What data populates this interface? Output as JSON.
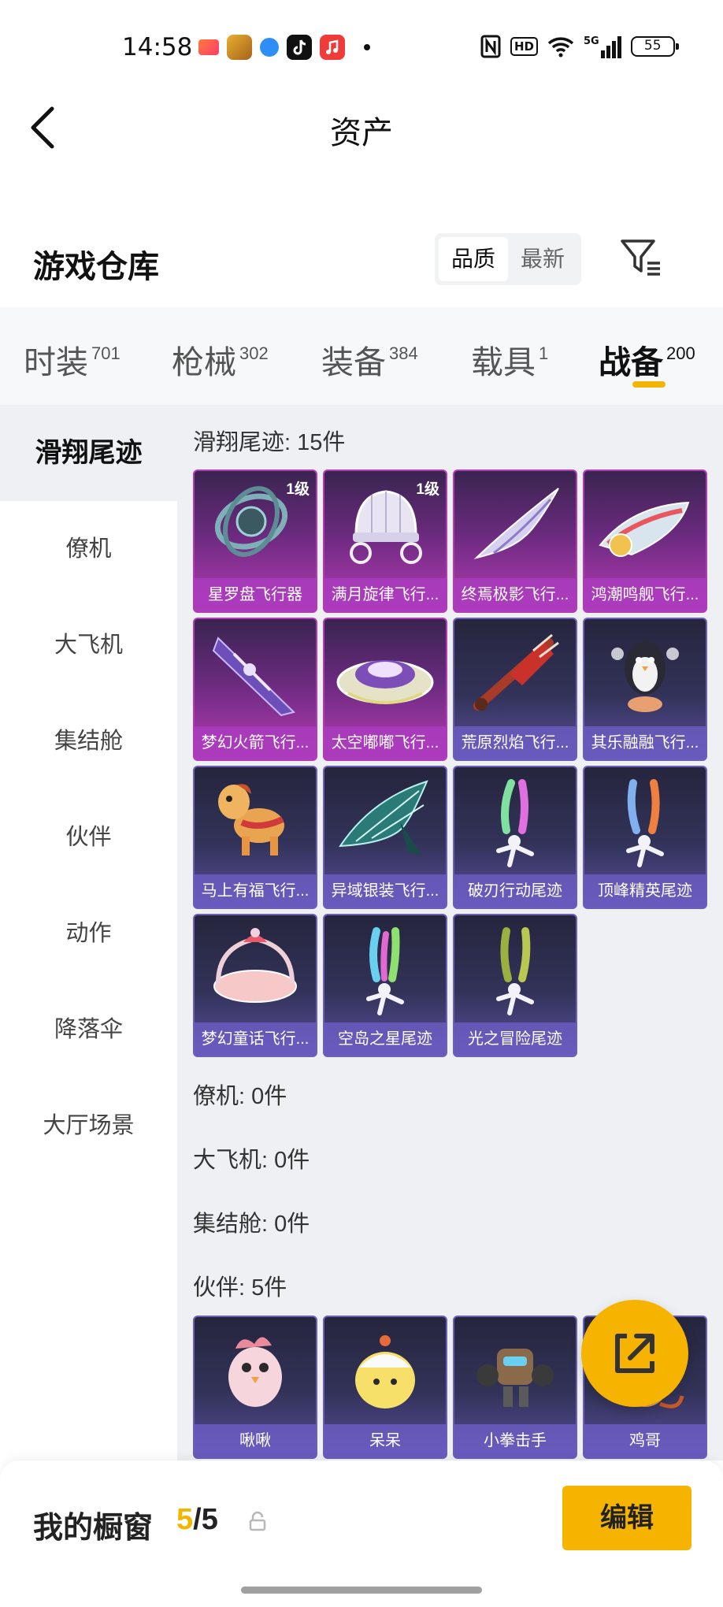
{
  "status": {
    "time": "14:58",
    "net": "5G",
    "hd": "HD",
    "battery": "55"
  },
  "header": {
    "title": "资产"
  },
  "section": {
    "title": "游戏仓库",
    "sort_options": [
      "品质",
      "最新"
    ]
  },
  "tabs": [
    {
      "label": "时装",
      "count": "701"
    },
    {
      "label": "枪械",
      "count": "302"
    },
    {
      "label": "装备",
      "count": "384"
    },
    {
      "label": "载具",
      "count": "1"
    },
    {
      "label": "战备",
      "count": "200"
    }
  ],
  "sidebar": {
    "items": [
      "滑翔尾迹",
      "僚机",
      "大飞机",
      "集结舱",
      "伙伴",
      "动作",
      "降落伞",
      "大厅场景"
    ]
  },
  "groups": {
    "glide": {
      "title": "滑翔尾迹: 15件",
      "items": [
        {
          "name": "星罗盘飞行器",
          "level": "1级",
          "rarity": "purple",
          "icon": "astrolabe-icon"
        },
        {
          "name": "满月旋律飞行...",
          "level": "1级",
          "rarity": "purple",
          "icon": "carriage-icon"
        },
        {
          "name": "终焉极影飞行...",
          "rarity": "purple",
          "icon": "wing-blade-icon"
        },
        {
          "name": "鸿潮鸣舰飞行...",
          "rarity": "purple",
          "icon": "hover-ship-icon"
        },
        {
          "name": "梦幻火箭飞行...",
          "rarity": "purple",
          "icon": "rocket-glider-icon"
        },
        {
          "name": "太空嘟嘟飞行...",
          "rarity": "purple",
          "icon": "ufo-icon"
        },
        {
          "name": "荒原烈焰飞行...",
          "rarity": "blue",
          "icon": "flame-glider-icon"
        },
        {
          "name": "其乐融融飞行...",
          "rarity": "blue",
          "icon": "penguin-icon"
        },
        {
          "name": "马上有福飞行...",
          "rarity": "blue",
          "icon": "pony-icon"
        },
        {
          "name": "异域银装飞行...",
          "rarity": "blue",
          "icon": "silver-wing-icon"
        },
        {
          "name": "破刃行动尾迹",
          "rarity": "blue",
          "icon": "smoke-trail-icon"
        },
        {
          "name": "顶峰精英尾迹",
          "rarity": "blue",
          "icon": "smoke-trail-icon"
        },
        {
          "name": "梦幻童话飞行...",
          "rarity": "blue",
          "icon": "fairy-carriage-icon"
        },
        {
          "name": "空岛之星尾迹",
          "rarity": "blue",
          "icon": "smoke-trail-icon"
        },
        {
          "name": "光之冒险尾迹",
          "rarity": "blue",
          "icon": "smoke-trail-icon"
        }
      ]
    },
    "wingman": {
      "title": "僚机: 0件"
    },
    "plane": {
      "title": "大飞机: 0件"
    },
    "pod": {
      "title": "集结舱: 0件"
    },
    "partner": {
      "title": "伙伴: 5件",
      "items": [
        {
          "name": "啾啾",
          "rarity": "blue",
          "icon": "pink-bird-icon"
        },
        {
          "name": "呆呆",
          "rarity": "blue",
          "icon": "yellow-chick-icon"
        },
        {
          "name": "小拳击手",
          "rarity": "blue",
          "icon": "robot-boxer-icon"
        },
        {
          "name": "鸡哥",
          "rarity": "blue",
          "icon": "rooster-icon"
        }
      ]
    }
  },
  "bottom": {
    "label": "我的橱窗",
    "current": "5",
    "total": "/5",
    "edit_label": "编辑"
  },
  "colors": {
    "accent": "#f6b400",
    "purple_rarity": "#b43bb8",
    "blue_rarity": "#6b5fb8"
  }
}
